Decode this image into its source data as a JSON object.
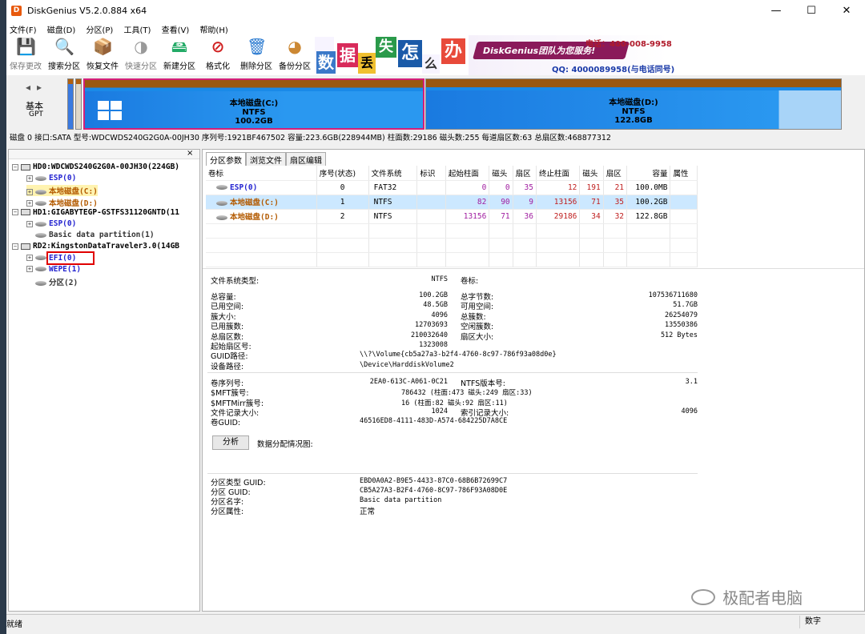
{
  "window": {
    "title": "DiskGenius V5.2.0.884 x64",
    "minimize": "—",
    "maximize": "☐",
    "close": "✕"
  },
  "menu": [
    "文件(F)",
    "磁盘(D)",
    "分区(P)",
    "工具(T)",
    "查看(V)",
    "帮助(H)"
  ],
  "toolbar": [
    {
      "label": "保存更改",
      "icon": "save-icon",
      "glyph": "💾"
    },
    {
      "label": "搜索分区",
      "icon": "search-icon",
      "glyph": "🔍"
    },
    {
      "label": "恢复文件",
      "icon": "restore-files-icon",
      "glyph": "📦"
    },
    {
      "label": "快速分区",
      "icon": "quick-partition-icon",
      "glyph": "◑"
    },
    {
      "label": "新建分区",
      "icon": "new-partition-icon",
      "glyph": "🖴"
    },
    {
      "label": "格式化",
      "icon": "format-icon",
      "glyph": "⊘"
    },
    {
      "label": "删除分区",
      "icon": "delete-partition-icon",
      "glyph": "🗑"
    },
    {
      "label": "备份分区",
      "icon": "backup-partition-icon",
      "glyph": "◕"
    }
  ],
  "banner": {
    "chars": [
      "数",
      "据",
      "丢",
      "失",
      "怎",
      "么",
      "办"
    ],
    "line1": "DiskGenius团队为您服务!",
    "phone": "电话：400-008-9958",
    "qq": "QQ: 4000089958(与电话同号)"
  },
  "disk_nav": {
    "basic": "基本",
    "gpt": "GPT"
  },
  "partitions_map": [
    {
      "name": "本地磁盘(C:)",
      "fs": "NTFS",
      "size": "100.2GB"
    },
    {
      "name": "本地磁盘(D:)",
      "fs": "NTFS",
      "size": "122.8GB"
    }
  ],
  "disk_info": "磁盘 0 接口:SATA  型号:WDCWDS240G2G0A-00JH30  序列号:1921BF467502  容量:223.6GB(228944MB)  柱面数:29186  磁头数:255  每道扇区数:63  总扇区数:468877312",
  "tree": [
    {
      "text": "HD0:WDCWDS240G2G0A-00JH30(224GB)",
      "level": 0,
      "kind": "disk",
      "color": "#000"
    },
    {
      "text": "ESP(0)",
      "level": 1,
      "kind": "part",
      "color": "#2323d0"
    },
    {
      "text": "本地磁盘(C:)",
      "level": 1,
      "kind": "part",
      "color": "#b35a00",
      "selected": true
    },
    {
      "text": "本地磁盘(D:)",
      "level": 1,
      "kind": "part",
      "color": "#b35a00"
    },
    {
      "text": "HD1:GIGABYTEGP-GSTFS31120GNTD(11",
      "level": 0,
      "kind": "disk",
      "color": "#000"
    },
    {
      "text": "ESP(0)",
      "level": 1,
      "kind": "part",
      "color": "#2323d0"
    },
    {
      "text": "Basic data partition(1)",
      "level": 1,
      "kind": "part",
      "color": "#333"
    },
    {
      "text": "RD2:KingstonDataTraveler3.0(14GB",
      "level": 0,
      "kind": "disk",
      "color": "#000"
    },
    {
      "text": "EFI(0)",
      "level": 1,
      "kind": "part",
      "color": "#2323d0",
      "highlight": true
    },
    {
      "text": "WEPE(1)",
      "level": 1,
      "kind": "part",
      "color": "#2323d0"
    },
    {
      "text": "分区(2)",
      "level": 1,
      "kind": "part",
      "color": "#333"
    }
  ],
  "tabs": [
    "分区参数",
    "浏览文件",
    "扇区编辑"
  ],
  "table": {
    "headers": [
      "卷标",
      "序号(状态)",
      "文件系统",
      "标识",
      "起始柱面",
      "磁头",
      "扇区",
      "终止柱面",
      "磁头",
      "扇区",
      "容量",
      "属性"
    ],
    "rows": [
      {
        "label": "ESP(0)",
        "cls": "c-blue",
        "cells": [
          "0",
          "FAT32",
          "",
          "0",
          "0",
          "35",
          "12",
          "191",
          "21",
          "100.0MB",
          ""
        ]
      },
      {
        "label": "本地磁盘(C:)",
        "cls": "c-brown",
        "cells": [
          "1",
          "NTFS",
          "",
          "82",
          "90",
          "9",
          "13156",
          "71",
          "35",
          "100.2GB",
          ""
        ],
        "selected": true
      },
      {
        "label": "本地磁盘(D:)",
        "cls": "c-brown",
        "cells": [
          "2",
          "NTFS",
          "",
          "13156",
          "71",
          "36",
          "29186",
          "34",
          "32",
          "122.8GB",
          ""
        ]
      }
    ]
  },
  "fsinfo": {
    "fs_type_label": "文件系统类型:",
    "fs_type": "NTFS",
    "vol_label": "卷标:",
    "left": [
      {
        "k": "总容量:",
        "v": "100.2GB"
      },
      {
        "k": "已用空间:",
        "v": "48.5GB"
      },
      {
        "k": "簇大小:",
        "v": "4096"
      },
      {
        "k": "已用簇数:",
        "v": "12703693"
      },
      {
        "k": "总扇区数:",
        "v": "210032640"
      },
      {
        "k": "起始扇区号:",
        "v": "1323008"
      }
    ],
    "right": [
      {
        "k": "总字节数:",
        "v": "107536711680"
      },
      {
        "k": "可用空间:",
        "v": "51.7GB"
      },
      {
        "k": "总簇数:",
        "v": "26254079"
      },
      {
        "k": "空闲簇数:",
        "v": "13550386"
      },
      {
        "k": "扇区大小:",
        "v": "512 Bytes"
      }
    ],
    "guid_path_label": "GUID路径:",
    "guid_path": "\\\\?\\Volume{cb5a27a3-b2f4-4760-8c97-786f93a08d0e}",
    "device_path_label": "设备路径:",
    "device_path": "\\Device\\HarddiskVolume2",
    "ntfs": [
      {
        "k": "卷序列号:",
        "v": "2EA0-613C-A061-0C21",
        "k2": "NTFS版本号:",
        "v2": "3.1"
      },
      {
        "k": "$MFT簇号:",
        "v": "786432 (柱面:473 磁头:249 扇区:33)",
        "k2": "",
        "v2": ""
      },
      {
        "k": "$MFTMirr簇号:",
        "v": "16 (柱面:82 磁头:92 扇区:11)",
        "k2": "",
        "v2": ""
      },
      {
        "k": "文件记录大小:",
        "v": "1024",
        "k2": "索引记录大小:",
        "v2": "4096"
      }
    ],
    "vol_guid_label": "卷GUID:",
    "vol_guid": "46516ED8-4111-483D-A574-684225D7A8CE",
    "analyze_button": "分析",
    "alloc_label": "数据分配情况图:",
    "part_type_guid_label": "分区类型 GUID:",
    "part_type_guid": "EBD0A0A2-B9E5-4433-87C0-68B6B72699C7",
    "part_guid_label": "分区 GUID:",
    "part_guid": "CB5A27A3-B2F4-4760-8C97-786F93A08D0E",
    "part_name_label": "分区名字:",
    "part_name": "Basic data partition",
    "part_attr_label": "分区属性:",
    "part_attr": "正常"
  },
  "watermark": "极配者电脑",
  "status": {
    "left": "就绪",
    "right": "数字"
  }
}
